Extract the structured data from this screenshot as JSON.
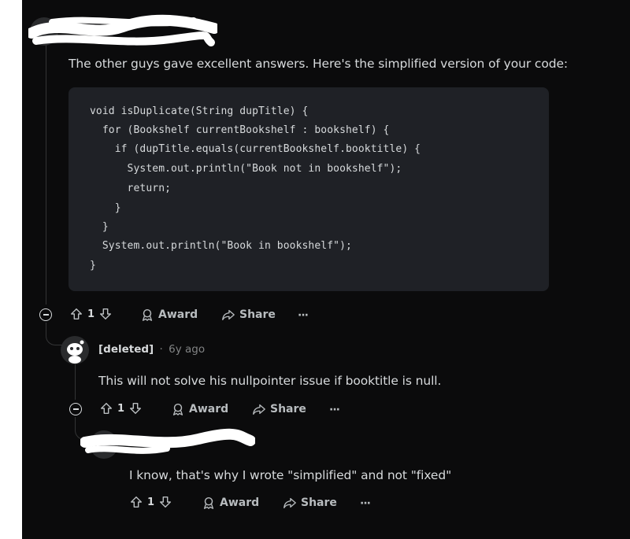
{
  "top_comment": {
    "body": "The other guys gave excellent answers. Here's the simplified version of your code:",
    "code_lines": [
      "void isDuplicate(String dupTitle) {",
      "  for (Bookshelf currentBookshelf : bookshelf) {",
      "    if (dupTitle.equals(currentBookshelf.booktitle) {",
      "      System.out.println(\"Book not in bookshelf\");",
      "      return;",
      "    }",
      "  }",
      "  System.out.println(\"Book in bookshelf\");",
      "}"
    ],
    "actions": {
      "votes": "1",
      "award": "Award",
      "share": "Share",
      "more": "···"
    }
  },
  "reply1": {
    "author": "[deleted]",
    "separator": "·",
    "time": "6y ago",
    "body": "This will not solve his nullpointer issue if booktitle is null.",
    "actions": {
      "votes": "1",
      "award": "Award",
      "share": "Share",
      "more": "···"
    }
  },
  "reply2": {
    "body": "I know, that's why I wrote \"simplified\" and not \"fixed\"",
    "actions": {
      "votes": "1",
      "award": "Award",
      "share": "Share",
      "more": "···"
    }
  },
  "colors": {
    "background": "#0b0b0c",
    "code_bg": "#1f2126",
    "text": "#d7dadc",
    "muted": "#818384"
  }
}
